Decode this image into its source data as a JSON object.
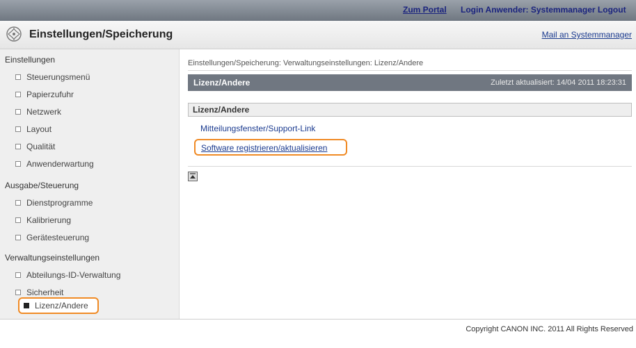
{
  "topbar": {
    "portal": "Zum Portal",
    "login": "Login Anwender: Systemmanager Logout"
  },
  "header": {
    "title": "Einstellungen/Speicherung",
    "mail_link": "Mail an Systemmanager"
  },
  "sidebar": {
    "sections": [
      {
        "title": "Einstellungen"
      },
      {
        "title": "Ausgabe/Steuerung"
      },
      {
        "title": "Verwaltungseinstellungen"
      }
    ],
    "items": [
      {
        "label": "Steuerungsmenü"
      },
      {
        "label": "Papierzufuhr"
      },
      {
        "label": "Netzwerk"
      },
      {
        "label": "Layout"
      },
      {
        "label": "Qualität"
      },
      {
        "label": "Anwenderwartung"
      },
      {
        "label": "Dienstprogramme"
      },
      {
        "label": "Kalibrierung"
      },
      {
        "label": "Gerätesteuerung"
      },
      {
        "label": "Abteilungs-ID-Verwaltung"
      },
      {
        "label": "Sicherheit"
      },
      {
        "label": "Lizenz/Andere",
        "active": true
      }
    ]
  },
  "main": {
    "breadcrumb": "Einstellungen/Speicherung: Verwaltungseinstellungen: Lizenz/Andere",
    "title": "Lizenz/Andere",
    "updated": "Zuletzt aktualisiert: 14/04 2011 18:23:31",
    "subheader": "Lizenz/Andere",
    "links": [
      {
        "label": "Mitteilungsfenster/Support-Link"
      },
      {
        "label": "Software registrieren/aktualisieren"
      }
    ]
  },
  "footer": {
    "copyright": "Copyright CANON INC. 2011 All Rights Reserved"
  },
  "colors": {
    "highlight": "#f08a24",
    "titlebar": "#707781",
    "link": "#1a3a8f"
  }
}
